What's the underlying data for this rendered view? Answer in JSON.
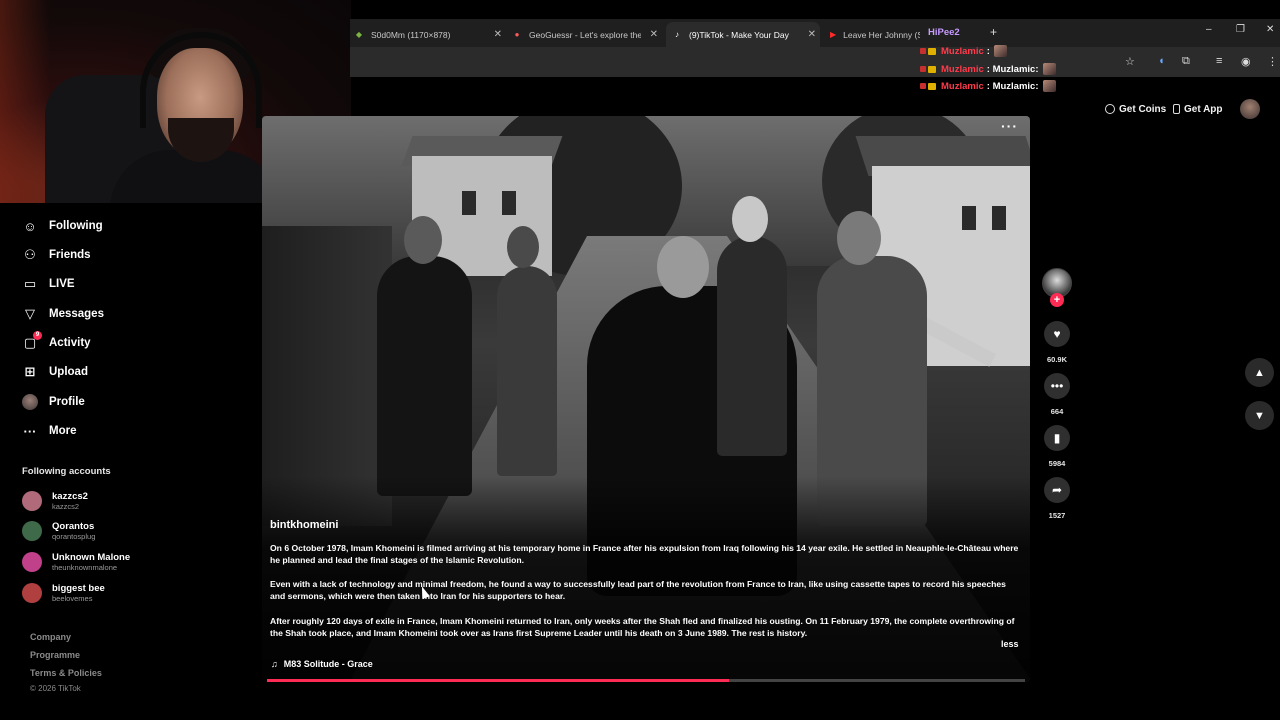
{
  "browser": {
    "tabs": [
      {
        "title": "S0d0Mm (1170×878)",
        "icon": "image-icon"
      },
      {
        "title": "GeoGuessr - Let's explore the w",
        "icon": "location-pin-icon"
      },
      {
        "title": "(9)TikTok - Make Your Day",
        "icon": "tiktok-icon"
      },
      {
        "title": "Leave Her Johnny (S",
        "icon": "youtube-icon"
      }
    ],
    "new_tab": "+",
    "window_controls": {
      "minimize": "–",
      "maximize": "❐",
      "close": "✕"
    }
  },
  "chat": {
    "first_user": "HiPee2",
    "lines": [
      {
        "user": "Muzlamic",
        "msg": ":"
      },
      {
        "user": "Muzlamic",
        "msg": ": Muzlamic:"
      },
      {
        "user": "Muzlamic",
        "msg": ": Muzlamic:"
      }
    ]
  },
  "header": {
    "get_coins": "Get Coins",
    "get_app": "Get App"
  },
  "sidebar": {
    "items": [
      {
        "label": "Following",
        "icon": "following-icon"
      },
      {
        "label": "Friends",
        "icon": "friends-icon"
      },
      {
        "label": "LIVE",
        "icon": "live-icon"
      },
      {
        "label": "Messages",
        "icon": "messages-icon"
      },
      {
        "label": "Activity",
        "icon": "activity-icon",
        "badge": "9"
      },
      {
        "label": "Upload",
        "icon": "upload-icon"
      },
      {
        "label": "Profile",
        "icon": "avatar"
      },
      {
        "label": "More",
        "icon": "more-icon"
      }
    ],
    "following_title": "Following accounts",
    "accounts": [
      {
        "name": "kazzcs2",
        "handle": "kazzcs2",
        "color": "#b06a7a"
      },
      {
        "name": "Qorantos",
        "handle": "qorantosplug",
        "color": "#3f6a4a"
      },
      {
        "name": "Unknown Malone",
        "handle": "theunknownmalone",
        "color": "#c0408a"
      },
      {
        "name": "biggest bee",
        "handle": "beelovemes",
        "color": "#b04040"
      }
    ],
    "footer": {
      "company": "Company",
      "programme": "Programme",
      "terms": "Terms & Policies",
      "copyright": "© 2026 TikTok"
    }
  },
  "video": {
    "username": "bintkhomeini",
    "paragraphs": [
      "On 6 October 1978, Imam Khomeini is filmed arriving at his temporary home in France after his expulsion from Iraq following his 14 year exile. He settled in Neauphle-le-Château where he planned and lead the final stages of the Islamic Revolution.",
      "Even with a lack of technology and minimal freedom, he found a way to successfully lead part of the revolution from France to Iran, like using cassette tapes to record his speeches and sermons, which were then taken into Iran for his supporters to hear.",
      "After roughly 120 days of exile in France, Imam Khomeini returned to Iran, only weeks after the Shah fled and finalized his ousting. On 11 February 1979, the complete overthrowing of the Shah took place, and Imam Khomeini took over as Irans first Supreme Leader until his death on 3 June 1989. The rest is history."
    ],
    "less_label": "less",
    "music": "M83 Solitude - Grace",
    "progress": 0.61,
    "more_label": "···"
  },
  "actions": {
    "likes": "60.9K",
    "comments": "664",
    "saves": "5984",
    "shares": "1527",
    "follow_label": "+"
  },
  "colors": {
    "accent": "#fe2c55",
    "background": "#000000"
  }
}
